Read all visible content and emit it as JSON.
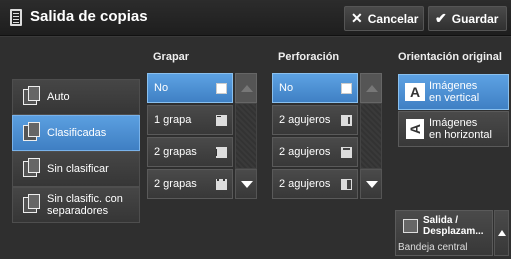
{
  "header": {
    "title": "Salida de copias",
    "cancel_label": "Cancelar",
    "save_label": "Guardar"
  },
  "modes": [
    {
      "label": "Auto",
      "selected": false
    },
    {
      "label": "Clasificadas",
      "selected": true
    },
    {
      "label": "Sin clasificar",
      "selected": false
    },
    {
      "label_line1": "Sin clasific. con",
      "label_line2": "separadores",
      "selected": false
    }
  ],
  "staple": {
    "heading": "Grapar",
    "options": [
      {
        "label": "No",
        "selected": true
      },
      {
        "label": "1 grapa",
        "selected": false
      },
      {
        "label": "2 grapas",
        "selected": false
      },
      {
        "label": "2 grapas",
        "selected": false
      }
    ]
  },
  "punch": {
    "heading": "Perforación",
    "options": [
      {
        "label": "No",
        "selected": true
      },
      {
        "label": "2 agujeros",
        "selected": false
      },
      {
        "label": "2 agujeros",
        "selected": false
      },
      {
        "label": "2 agujeros",
        "selected": false
      }
    ]
  },
  "orientation": {
    "heading": "Orientación original",
    "options": [
      {
        "line1": "Imágenes",
        "line2": "en vertical",
        "icon": "A",
        "selected": true
      },
      {
        "line1": "Imágenes",
        "line2": "en horizontal",
        "icon": "A",
        "selected": false
      }
    ]
  },
  "output": {
    "line1": "Salida /",
    "line2": "Desplazam...",
    "sub": "Bandeja central"
  },
  "colors": {
    "accent": "#4a8fd4",
    "background": "#2f2f2f"
  }
}
